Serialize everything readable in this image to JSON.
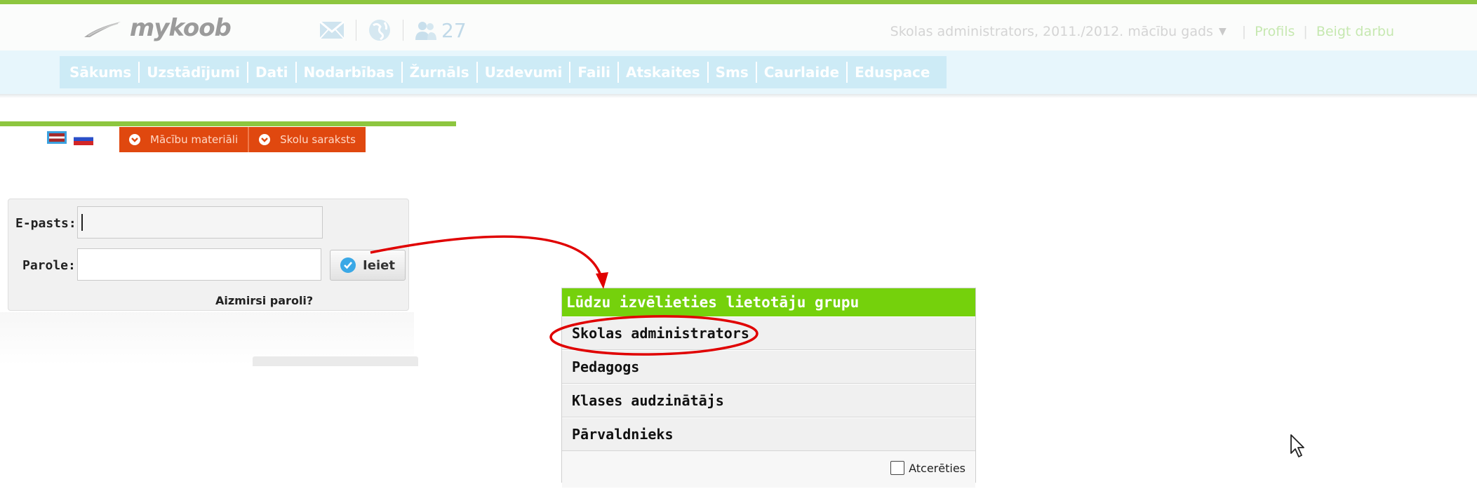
{
  "header": {
    "logo_text": "mykoob",
    "notification_count": "27",
    "role_period": "Skolas administrators, 2011./2012. mācību gads",
    "profile_link": "Profils",
    "logout_link": "Beigt darbu",
    "icons": [
      "mail-icon",
      "globe-icon",
      "people-icon",
      "chevron-down-icon"
    ]
  },
  "nav": {
    "items": [
      {
        "label": "Sākums"
      },
      {
        "label": "Uzstādījumi"
      },
      {
        "label": "Dati"
      },
      {
        "label": "Nodarbības"
      },
      {
        "label": "Žurnāls"
      },
      {
        "label": "Uzdevumi"
      },
      {
        "label": "Faili"
      },
      {
        "label": "Atskaites"
      },
      {
        "label": "Sms"
      },
      {
        "label": "Caurlaide"
      },
      {
        "label": "Eduspace"
      }
    ]
  },
  "login": {
    "tabs": [
      {
        "label": "Mācību materiāli"
      },
      {
        "label": "Skolu saraksts"
      }
    ],
    "email_label": "E-pasts:",
    "email_value": "",
    "password_label": "Parole:",
    "password_value": "",
    "submit_label": "Ieiet",
    "forgot_label": "Aizmirsi paroli?"
  },
  "group_select": {
    "title": "Lūdzu izvēlieties lietotāju grupu",
    "options": [
      {
        "label": "Skolas administrators"
      },
      {
        "label": "Pedagogs"
      },
      {
        "label": "Klases audzinātājs"
      },
      {
        "label": "Pārvaldnieks"
      }
    ],
    "remember_label": "Atcerēties",
    "remember_checked": false
  },
  "colors": {
    "accent_green": "#8dc63f",
    "title_green": "#75d10c",
    "nav_blue": "#cdebf6",
    "tab_orange": "#e0480f",
    "annotation_red": "#e00000"
  }
}
